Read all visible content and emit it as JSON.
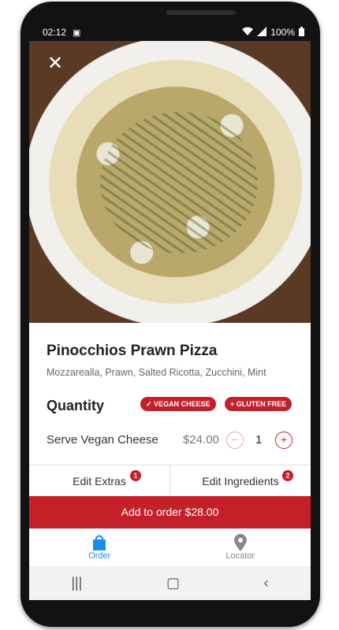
{
  "status": {
    "time": "02:12",
    "battery": "100%"
  },
  "item": {
    "title": "Pinocchios Prawn Pizza",
    "description": "Mozzarealla, Prawn, Salted Ricotta, Zucchini, Mint"
  },
  "quantity_section": {
    "label": "Quantity",
    "badges": [
      "VEGAN CHEESE",
      "GLUTEN FREE"
    ]
  },
  "serve": {
    "label": "Serve Vegan Cheese",
    "price": "$24.00",
    "quantity": "1"
  },
  "edit": {
    "extras_label": "Edit Extras",
    "extras_count": "1",
    "ingredients_label": "Edit Ingredients",
    "ingredients_count": "2"
  },
  "add_button_label": "Add to order $28.00",
  "tabs": [
    {
      "label": "Order",
      "icon": "shopping-bag-icon",
      "active": true
    },
    {
      "label": "Locator",
      "icon": "location-pin-icon",
      "active": false
    }
  ],
  "colors": {
    "accent": "#c4202a",
    "tab_active": "#1a8cf0"
  }
}
